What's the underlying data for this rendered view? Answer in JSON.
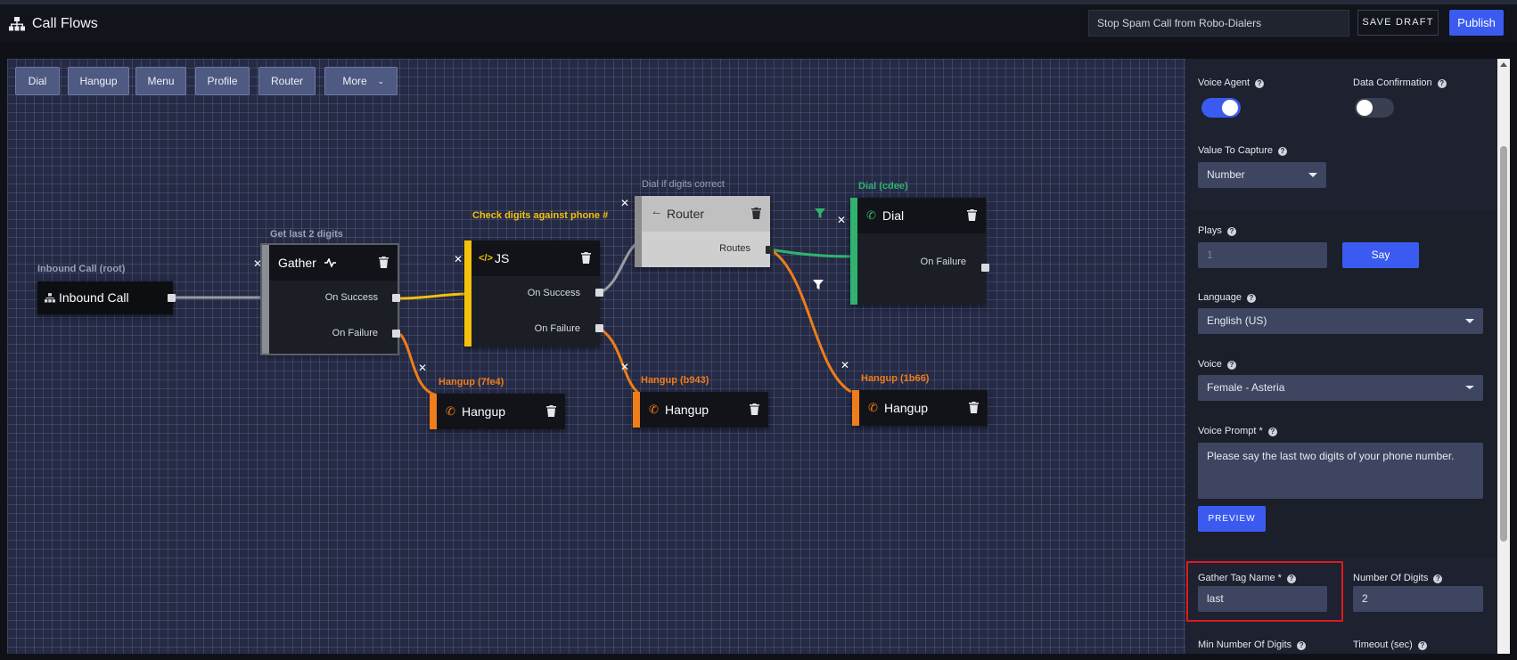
{
  "header": {
    "title": "Call Flows",
    "flow_name": "Stop Spam Call from Robo-Dialers",
    "save_draft_label": "SAVE DRAFT",
    "publish_label": "Publish"
  },
  "toolbar": {
    "dial": "Dial",
    "hangup": "Hangup",
    "menu": "Menu",
    "profile": "Profile",
    "router": "Router",
    "more": "More"
  },
  "nodes": {
    "inbound": {
      "caption": "Inbound Call (root)",
      "title": "Inbound Call"
    },
    "gather": {
      "caption": "Get last 2 digits",
      "title": "Gather",
      "success": "On Success",
      "failure": "On Failure"
    },
    "js": {
      "caption": "Check digits against phone #",
      "title": "JS",
      "success": "On Success",
      "failure": "On Failure"
    },
    "router": {
      "caption": "Dial if digits correct",
      "title": "Router",
      "routes": "Routes"
    },
    "dial": {
      "caption": "Dial (cdee)",
      "title": "Dial",
      "failure": "On Failure"
    },
    "hangup1": {
      "caption": "Hangup (7fe4)",
      "title": "Hangup"
    },
    "hangup2": {
      "caption": "Hangup (b943)",
      "title": "Hangup"
    },
    "hangup3": {
      "caption": "Hangup (1b66)",
      "title": "Hangup"
    }
  },
  "panel": {
    "voice_agent": {
      "label": "Voice Agent",
      "on": true
    },
    "data_confirmation": {
      "label": "Data Confirmation",
      "on": false
    },
    "value_to_capture": {
      "label": "Value To Capture",
      "value": "Number"
    },
    "plays": {
      "label": "Plays",
      "placeholder": "1"
    },
    "say_label": "Say",
    "language": {
      "label": "Language",
      "value": "English (US)"
    },
    "voice": {
      "label": "Voice",
      "value": "Female - Asteria"
    },
    "voice_prompt": {
      "label": "Voice Prompt *",
      "value": "Please say the last two digits of your phone number."
    },
    "preview_label": "PREVIEW",
    "gather_tag": {
      "label": "Gather Tag Name *",
      "value": "last"
    },
    "num_digits": {
      "label": "Number Of Digits",
      "value": "2"
    },
    "min_digits": {
      "label": "Min Number Of Digits"
    },
    "timeout": {
      "label": "Timeout (sec)"
    }
  },
  "colors": {
    "accent": "#3b5bf0",
    "gather": "#8a8d94",
    "js": "#f4c20d",
    "router": "#8c8c8c",
    "dial": "#2fb36f",
    "hangup": "#ef7d1a",
    "highlight": "#e0191f"
  }
}
